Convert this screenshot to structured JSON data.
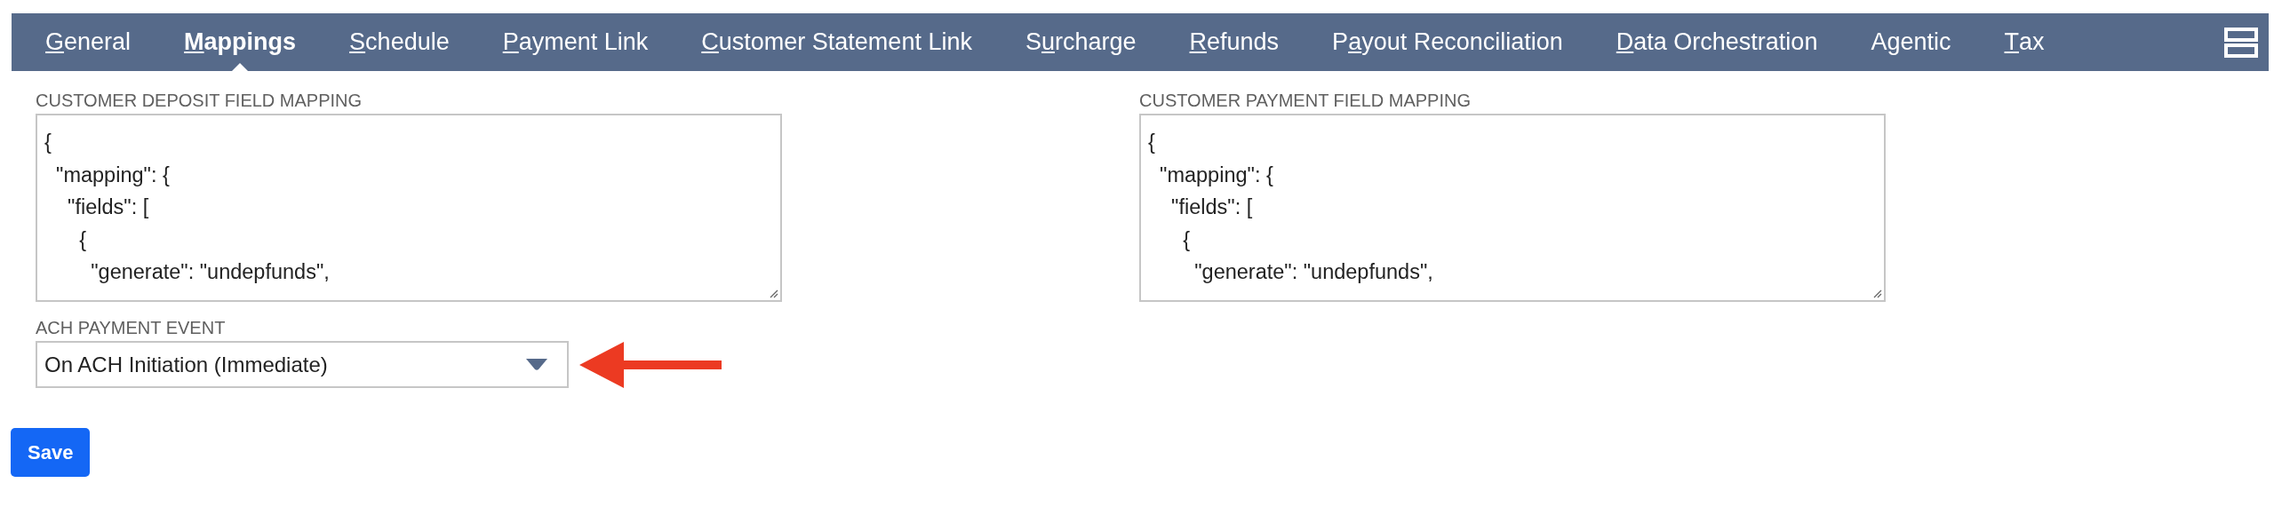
{
  "tabs": [
    {
      "key": "G",
      "post": "eneral",
      "selected": false
    },
    {
      "key": "M",
      "post": "appings",
      "selected": true
    },
    {
      "key": "S",
      "post": "chedule",
      "selected": false
    },
    {
      "key": "P",
      "post": "ayment Link",
      "selected": false
    },
    {
      "key": "C",
      "post": "ustomer Statement Link",
      "selected": false
    },
    {
      "pre": "S",
      "key": "u",
      "post": "rcharge",
      "selected": false
    },
    {
      "key": "R",
      "post": "efunds",
      "selected": false
    },
    {
      "pre": "P",
      "key": "a",
      "post": "yout Reconciliation",
      "selected": false
    },
    {
      "key": "D",
      "post": "ata Orchestration",
      "selected": false
    },
    {
      "pre": "A",
      "key": "g",
      "post": "entic",
      "selected": false
    },
    {
      "key": "T",
      "post": "ax",
      "selected": false
    }
  ],
  "mappings": [
    {
      "label": "CUSTOMER DEPOSIT FIELD MAPPING",
      "lines": [
        "{",
        "  \"mapping\": {",
        "    \"fields\": [",
        "      {",
        "        \"generate\": \"undepfunds\","
      ]
    },
    {
      "label": "CUSTOMER PAYMENT FIELD MAPPING",
      "lines": [
        "{",
        "  \"mapping\": {",
        "    \"fields\": [",
        "      {",
        "        \"generate\": \"undepfunds\","
      ]
    }
  ],
  "ach_payment_event": {
    "label": "ACH PAYMENT EVENT",
    "value": "On ACH Initiation (Immediate)"
  },
  "buttons": [
    "Save"
  ]
}
